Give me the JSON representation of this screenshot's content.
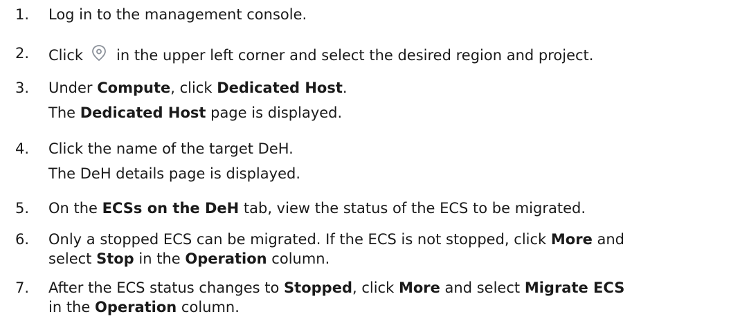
{
  "steps": [
    {
      "number": "1.",
      "parts": [
        "Log in to the management console."
      ]
    },
    {
      "number": "2.",
      "before_icon": "Click",
      "icon": "location-pin-icon",
      "after_icon": "in the upper left corner and select the desired region and project."
    },
    {
      "number": "3.",
      "t1": "Under ",
      "b1": "Compute",
      "t2": ", click ",
      "b2": "Dedicated Host",
      "t3": ".",
      "note": {
        "t1": "The ",
        "b1": "Dedicated Host",
        "t2": " page is displayed."
      }
    },
    {
      "number": "4.",
      "text": "Click the name of the target DeH.",
      "note": "The DeH details page is displayed."
    },
    {
      "number": "5.",
      "t1": "On the ",
      "b1": "ECSs on the DeH",
      "t2": " tab, view the status of the ECS to be migrated."
    },
    {
      "number": "6.",
      "t1": "Only a stopped ECS can be migrated. If the ECS is not stopped, click ",
      "b1": "More",
      "t2": " and",
      "t3": "select ",
      "b2": "Stop",
      "t4": " in the ",
      "b3": "Operation",
      "t5": " column."
    },
    {
      "number": "7.",
      "t1": "After the ECS status changes to ",
      "b1": "Stopped",
      "t2": ", click ",
      "b2": "More",
      "t3": " and select ",
      "b3": "Migrate ECS",
      "t4": "in the ",
      "b4": "Operation",
      "t5": " column."
    }
  ],
  "colors": {
    "text": "#1a1a1a",
    "icon": "#8a9099"
  }
}
